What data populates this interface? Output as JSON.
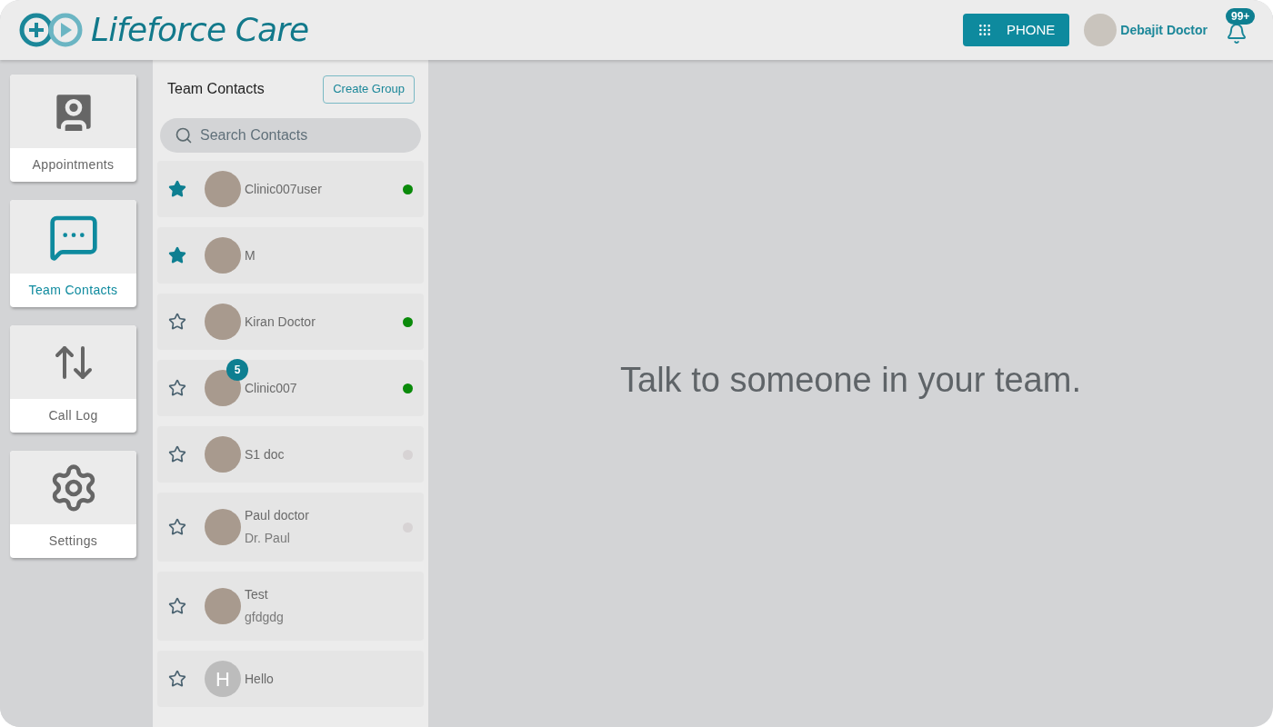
{
  "header": {
    "brand": "Lifeforce Care",
    "phone_button": "PHONE",
    "user_name": "Debajit Doctor",
    "notification_count": "99+"
  },
  "nav": [
    {
      "kind": "appointments",
      "label": "Appointments",
      "selected": false
    },
    {
      "kind": "chat",
      "label": "Team Contacts",
      "selected": true
    },
    {
      "kind": "calllog",
      "label": "Call Log",
      "selected": false
    },
    {
      "kind": "settings",
      "label": "Settings",
      "selected": false
    }
  ],
  "contacts_panel": {
    "title": "Team Contacts",
    "create_button": "Create Group",
    "search": {
      "placeholder": "Search Contacts"
    },
    "contacts": [
      {
        "name": "Clinic007user",
        "favorite": true,
        "color": "#0a8a0a",
        "avatar": {
          "kind": "photo"
        }
      },
      {
        "name": "M",
        "favorite": true,
        "avatar": {
          "kind": "photo"
        }
      },
      {
        "name": "Kiran Doctor",
        "favorite": false,
        "color": "#0a8a0a",
        "avatar": {
          "kind": "photo"
        }
      },
      {
        "name": "Clinic007",
        "favorite": false,
        "color": "#0a8a0a",
        "unread": "5",
        "avatar": {
          "kind": "photo"
        }
      },
      {
        "name": "S1 doc",
        "favorite": false,
        "color": "#d7d3d4",
        "avatar": {
          "kind": "photo"
        }
      },
      {
        "name": "Paul doctor",
        "subtitle": "Dr. Paul",
        "favorite": false,
        "color": "#d7d3d4",
        "avatar": {
          "kind": "photo"
        }
      },
      {
        "name": "Test",
        "subtitle": "gfdgdg",
        "favorite": false,
        "avatar": {
          "kind": "photo"
        }
      },
      {
        "name": "Hello",
        "favorite": false,
        "avatar": {
          "kind": "initial",
          "initial": "H"
        }
      }
    ]
  },
  "main": {
    "message": "Talk to someone in your team."
  }
}
